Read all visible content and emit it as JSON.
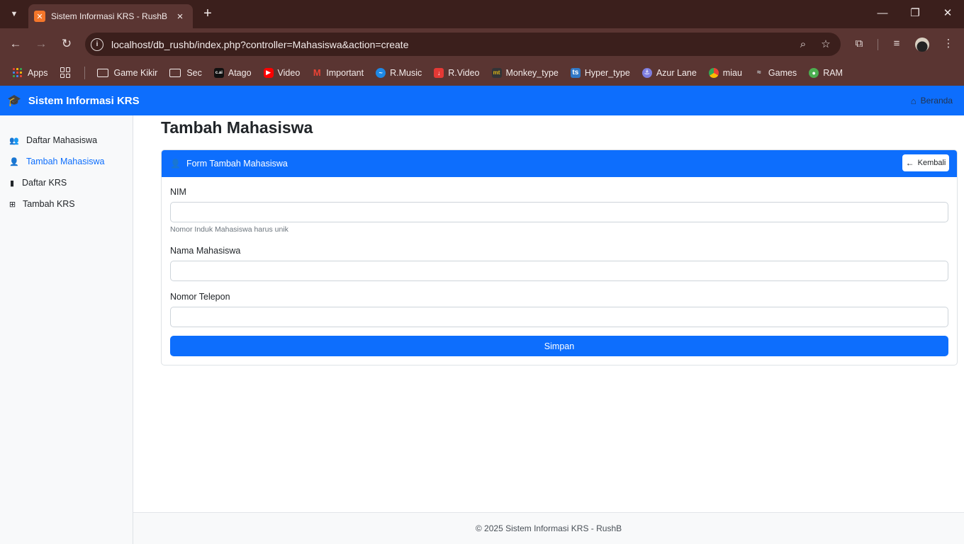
{
  "browser": {
    "tab_title": "Sistem Informasi KRS - RushB",
    "url": "localhost/db_rushb/index.php?controller=Mahasiswa&action=create",
    "bookmarks": [
      {
        "label": "Apps",
        "icon": "apps-grid-icon"
      },
      {
        "label": "Game Kikir",
        "icon": "folder-icon"
      },
      {
        "label": "Sec",
        "icon": "folder-icon"
      },
      {
        "label": "Atago",
        "icon": "cai-icon"
      },
      {
        "label": "Video",
        "icon": "youtube-icon"
      },
      {
        "label": "Important",
        "icon": "gmail-icon"
      },
      {
        "label": "R.Music",
        "icon": "music-icon"
      },
      {
        "label": "R.Video",
        "icon": "download-icon"
      },
      {
        "label": "Monkey_type",
        "icon": "monkeytype-icon"
      },
      {
        "label": "Hyper_type",
        "icon": "typescript-icon"
      },
      {
        "label": "Azur Lane",
        "icon": "azurlane-icon"
      },
      {
        "label": "miau",
        "icon": "chrome-icon"
      },
      {
        "label": "Games",
        "icon": "games-icon"
      },
      {
        "label": "RAM",
        "icon": "ram-icon"
      }
    ],
    "cai_badge": "c.ai",
    "mt_badge": "mt",
    "ts_badge": "ts"
  },
  "navbar": {
    "brand": "Sistem Informasi KRS",
    "home_link": "Beranda"
  },
  "sidebar": {
    "items": [
      {
        "label": "Daftar Mahasiswa",
        "icon": "users-icon",
        "active": false
      },
      {
        "label": "Tambah Mahasiswa",
        "icon": "user-plus-icon",
        "active": true
      },
      {
        "label": "Daftar KRS",
        "icon": "file-icon",
        "active": false
      },
      {
        "label": "Tambah KRS",
        "icon": "plus-square-icon",
        "active": false
      }
    ]
  },
  "main": {
    "page_title": "Tambah Mahasiswa",
    "card_title": "Form Tambah Mahasiswa",
    "back_label": "Kembali",
    "fields": [
      {
        "label": "NIM",
        "value": "",
        "help": "Nomor Induk Mahasiswa harus unik"
      },
      {
        "label": "Nama Mahasiswa",
        "value": ""
      },
      {
        "label": "Nomor Telepon",
        "value": ""
      }
    ],
    "submit_label": "Simpan"
  },
  "footer": {
    "text": "© 2025 Sistem Informasi KRS - RushB"
  },
  "colors": {
    "primary": "#0d6efd",
    "chrome_frame": "#3b1f1c",
    "chrome_toolbar": "#5a3532"
  }
}
